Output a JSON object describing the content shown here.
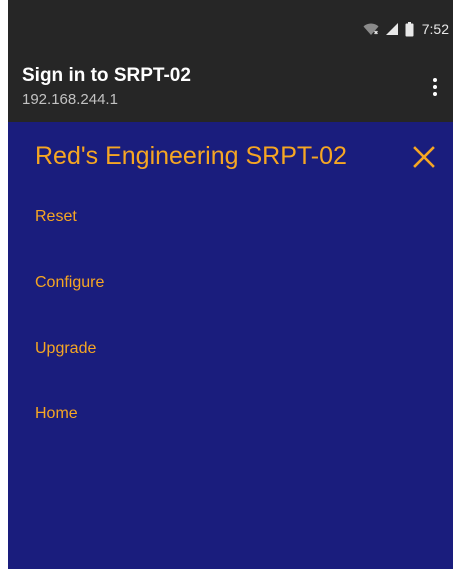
{
  "status_bar": {
    "time": "7:52",
    "icons": [
      "wifi-icon",
      "signal-icon",
      "battery-icon"
    ]
  },
  "app_bar": {
    "title": "Sign in to SRPT-02",
    "subtitle": "192.168.244.1",
    "menu_icon": "more-vert-icon"
  },
  "page": {
    "heading": "Red's Engineering SRPT-02",
    "close_icon": "close-icon",
    "nav": [
      {
        "label": "Reset"
      },
      {
        "label": "Configure"
      },
      {
        "label": "Upgrade"
      },
      {
        "label": "Home"
      }
    ]
  },
  "colors": {
    "background": "#1a1d7d",
    "accent": "#f6a623",
    "bar": "#262626"
  }
}
